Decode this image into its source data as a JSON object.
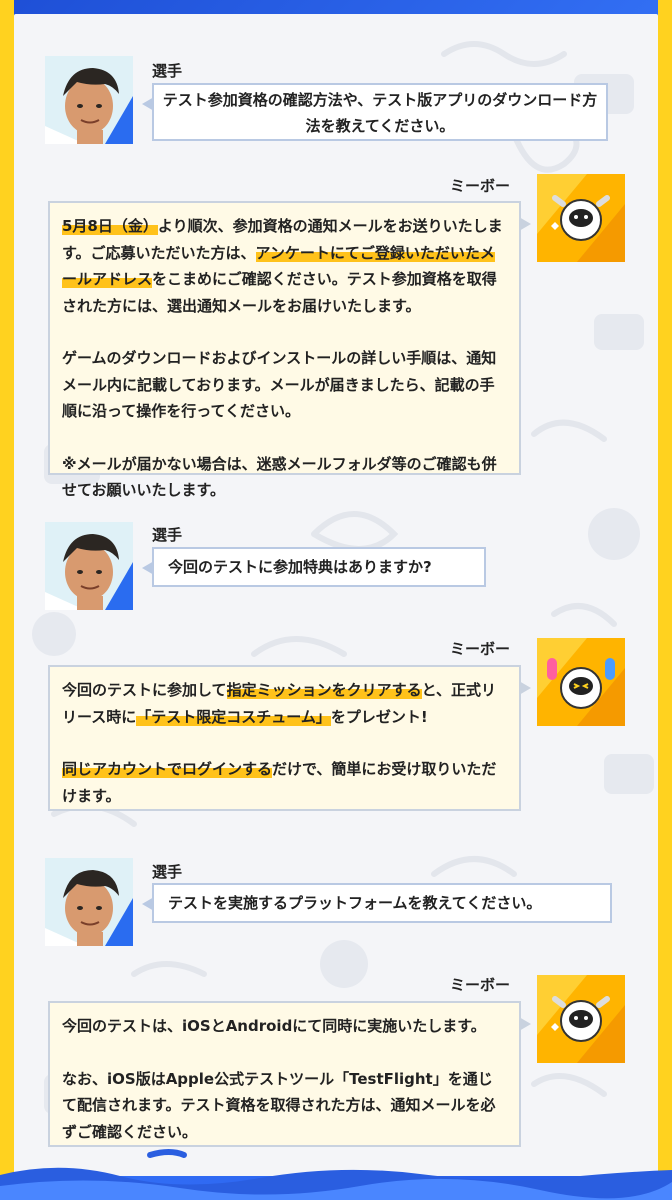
{
  "q1": {
    "speaker": "選手",
    "text": "テスト参加資格の確認方法や、テスト版アプリのダウンロード方法を教えてください。"
  },
  "a1": {
    "speaker": "ミーボー",
    "p1_hl1": "5月8日（金）",
    "p1_t1": "より順次、参加資格の通知メールをお送りいたします。ご応募いただいた方は、",
    "p1_hl2": "アンケートにてご登録いただいたメールアドレス",
    "p1_t2": "をこまめにご確認ください。テスト参加資格を取得された方には、選出通知メールをお届けいたします。",
    "p2": "ゲームのダウンロードおよびインストールの詳しい手順は、通知メール内に記載しております。メールが届きましたら、記載の手順に沿って操作を行ってください。",
    "p3": "※メールが届かない場合は、迷惑メールフォルダ等のご確認も併せてお願いいたします。"
  },
  "q2": {
    "speaker": "選手",
    "text": "今回のテストに参加特典はありますか?"
  },
  "a2": {
    "speaker": "ミーボー",
    "p1_t1": "今回のテストに参加して",
    "p1_hl1": "指定ミッションをクリアする",
    "p1_t2": "と、正式リリース時に",
    "p1_hl2": "「テスト限定コスチューム」",
    "p1_t3": "をプレゼント!",
    "p2_hl1": "同じアカウントでログインする",
    "p2_t1": "だけで、簡単にお受け取りいただけます。"
  },
  "q3": {
    "speaker": "選手",
    "text": "テストを実施するプラットフォームを教えてください。"
  },
  "a3": {
    "speaker": "ミーボー",
    "p1": "今回のテストは、iOSとAndroidにて同時に実施いたします。",
    "p2": "なお、iOS版はApple公式テストツール「TestFlight」を通じて配信されます。テスト資格を取得された方は、通知メールを必ずご確認ください。"
  }
}
